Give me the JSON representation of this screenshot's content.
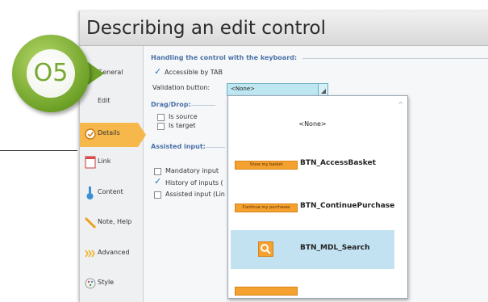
{
  "window": {
    "title": "Describing an edit control"
  },
  "badge": {
    "number": "O5",
    "accent": "#6ea127"
  },
  "sidebar": {
    "items": [
      {
        "label": "General",
        "icon": "general-icon"
      },
      {
        "label": "Edit",
        "icon": "edit-icon"
      },
      {
        "label": "Details",
        "icon": "details-icon",
        "active": true
      },
      {
        "label": "Link",
        "icon": "link-icon"
      },
      {
        "label": "Content",
        "icon": "content-icon"
      },
      {
        "label": "Note, Help",
        "icon": "note-icon"
      },
      {
        "label": "Advanced",
        "icon": "advanced-icon"
      },
      {
        "label": "Style",
        "icon": "style-icon"
      }
    ]
  },
  "keyboard": {
    "section_title": "Handling the control with the keyboard:",
    "accessible_label": "Accessible by TAB",
    "accessible_checked": true,
    "validation_label": "Validation button:",
    "validation_value": "<None>"
  },
  "dragdrop": {
    "section_title": "Drag/Drop:",
    "source_label": "Is source",
    "target_label": "Is target"
  },
  "assisted": {
    "section_title": "Assisted input:",
    "mandatory_label": "Mandatory input",
    "history_label": "History of inputs (",
    "history_checked": true,
    "assisted_label": "Assisted input (Lin"
  },
  "dropdown": {
    "none_label": "<None>",
    "items": [
      {
        "button_text": "Show my basket",
        "name": "BTN_AccessBasket"
      },
      {
        "button_text": "Continue my purchases",
        "name": "BTN_ContinuePurchase"
      },
      {
        "button_text": "",
        "name": "BTN_MDL_Search",
        "selected": true
      }
    ]
  }
}
